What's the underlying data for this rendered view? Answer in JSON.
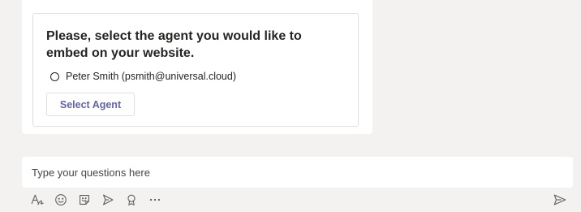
{
  "card": {
    "title": "Please, select the agent you would like to embed on your website.",
    "options": [
      {
        "label": "Peter Smith (psmith@universal.cloud)",
        "selected": false
      }
    ],
    "button_label": "Select Agent"
  },
  "compose": {
    "placeholder": "Type your questions here"
  },
  "toolbar": {
    "icons": [
      "format-icon",
      "emoji-icon",
      "sticker-icon",
      "stream-icon",
      "praise-icon",
      "more-options-icon"
    ],
    "send_icon": "send-icon"
  },
  "colors": {
    "accent": "#6264a7",
    "background": "#f3f2f1",
    "card_border": "#e1dfdd",
    "text": "#252423"
  }
}
